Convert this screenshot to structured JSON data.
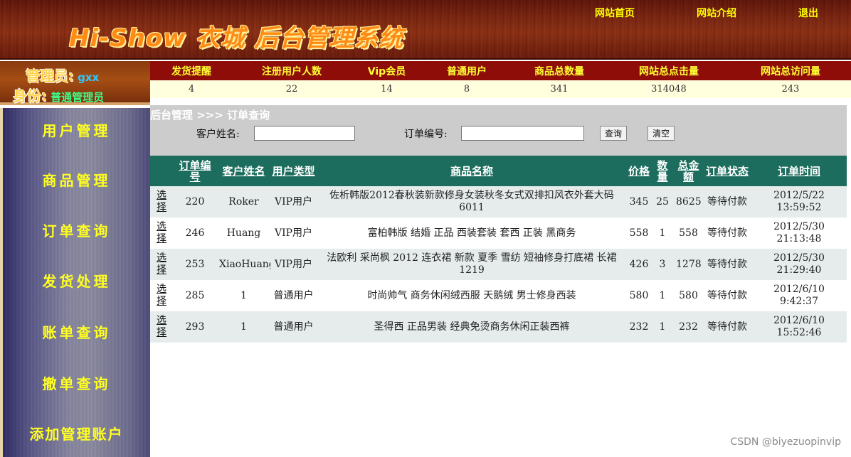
{
  "header": {
    "title": "Hi-Show 衣城 后台管理系统",
    "nav": [
      "网站首页",
      "网站介绍",
      "退出"
    ]
  },
  "admin": {
    "label_admin": "管理员:",
    "name": "gxx",
    "label_role": "身份:",
    "role": "普通管理员"
  },
  "stats": {
    "headers": [
      "发货提醒",
      "注册用户人数",
      "Vip会员",
      "普通用户",
      "商品总数量",
      "网站总点击量",
      "网站总访问量"
    ],
    "values": [
      "4",
      "22",
      "14",
      "8",
      "341",
      "314048",
      "243"
    ]
  },
  "sidebar": {
    "items": [
      "用户管理",
      "商品管理",
      "订单查询",
      "发货处理",
      "账单查询",
      "撤单查询",
      "添加管理账户"
    ]
  },
  "search": {
    "breadcrumb": "后台管理 >>> 订单查询",
    "customer_label": "客户姓名:",
    "customer_value": "",
    "order_label": "订单编号:",
    "order_value": "",
    "query_button": "查询",
    "clear_button": "清空"
  },
  "table": {
    "columns": [
      "",
      "订单编号",
      "客户姓名",
      "用户类型",
      "商品名称",
      "价格",
      "数量",
      "总金额",
      "订单状态",
      "订单时间"
    ],
    "rows": [
      {
        "select": "选择",
        "id": "220",
        "customer": "Roker",
        "type": "VIP用户",
        "product": "佐析韩版2012春秋装新款修身女装秋冬女式双排扣风衣外套大码6011",
        "price": "345",
        "qty": "25",
        "total": "8625",
        "status": "等待付款",
        "time": "2012/5/22 13:59:52"
      },
      {
        "select": "选择",
        "id": "246",
        "customer": "Huang",
        "type": "VIP用户",
        "product": "富柏韩版 结婚 正品 西装套装 套西 正装 黑商务",
        "price": "558",
        "qty": "1",
        "total": "558",
        "status": "等待付款",
        "time": "2012/5/30 21:13:48"
      },
      {
        "select": "选择",
        "id": "253",
        "customer": "XiaoHuang",
        "type": "VIP用户",
        "product": "法欧利 采尚枫 2012 连衣裙 新款 夏季 雪纺 短袖修身打底裙 长裙 1219",
        "price": "426",
        "qty": "3",
        "total": "1278",
        "status": "等待付款",
        "time": "2012/5/30 21:29:40"
      },
      {
        "select": "选择",
        "id": "285",
        "customer": "1",
        "type": "普通用户",
        "product": "时尚帅气 商务休闲绒西服 天鹅绒 男士修身西装",
        "price": "580",
        "qty": "1",
        "total": "580",
        "status": "等待付款",
        "time": "2012/6/10 9:42:37"
      },
      {
        "select": "选择",
        "id": "293",
        "customer": "1",
        "type": "普通用户",
        "product": "圣得西 正品男装 经典免烫商务休闲正装西裤",
        "price": "232",
        "qty": "1",
        "total": "232",
        "status": "等待付款",
        "time": "2012/6/10 15:52:46"
      }
    ]
  },
  "watermark": "CSDN @biyezuopinvip"
}
